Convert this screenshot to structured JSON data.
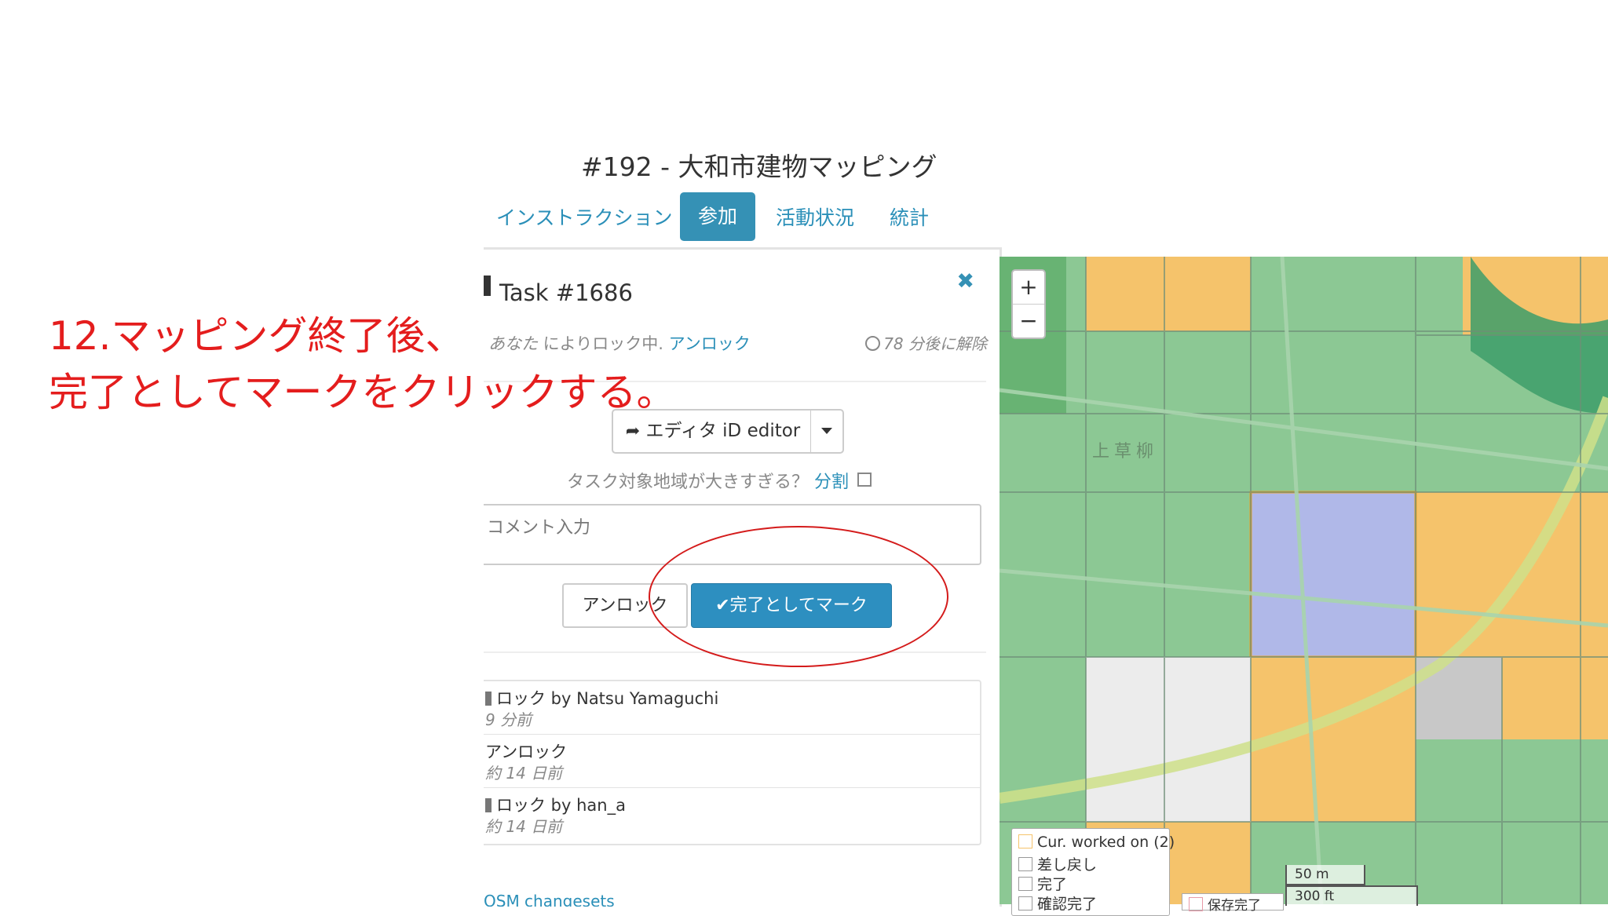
{
  "project": {
    "title": "#192 - 大和市建物マッピング"
  },
  "tabs": [
    {
      "label": "インストラクション"
    },
    {
      "label": "参加",
      "active": true
    },
    {
      "label": "活動状況"
    },
    {
      "label": "統計"
    }
  ],
  "task": {
    "heading": "Task #1686",
    "close_glyph": "✖",
    "locked_by_prefix": "あなた",
    "locked_by_suffix": " によりロック中.",
    "unlock_link": "アンロック",
    "timer": "78 分後に解除",
    "editor_label": "エディタ iD editor",
    "too_large_text": "タスク対象地域が大きすぎる？",
    "split_link": "分割",
    "comment_placeholder": "コメント入力",
    "unlock_button": "アンロック",
    "done_button": "完了としてマーク"
  },
  "history": [
    {
      "main": "ロック by Natsu Yamaguchi",
      "sub": "9 分前",
      "lock_icon": true
    },
    {
      "main": "アンロック",
      "sub": "約 14 日前",
      "lock_icon": false
    },
    {
      "main": "ロック by han_a",
      "sub": "約 14 日前",
      "lock_icon": true
    }
  ],
  "osm_changesets": "OSM changesets",
  "annotation": {
    "line1": "12.マッピング終了後、",
    "line2": "完了としてマークをクリックする。"
  },
  "map": {
    "zoom_in": "+",
    "zoom_out": "−",
    "place_label": "上草柳",
    "legend": [
      {
        "label": "Cur. worked on (2)",
        "color": "#f5c36b"
      },
      {
        "label": "差し戻し",
        "color": "#ffffff"
      },
      {
        "label": "完了",
        "color": "#ffffff"
      },
      {
        "label": "確認完了",
        "color": "#ffffff"
      }
    ],
    "legend2": "保存完了",
    "scale_m": "50 m",
    "scale_ft": "300 ft",
    "colors": {
      "done": "#8cc894",
      "locked": "#f5c36b",
      "selected": "#b0b8e8",
      "invalid": "#e8e8e8"
    }
  }
}
